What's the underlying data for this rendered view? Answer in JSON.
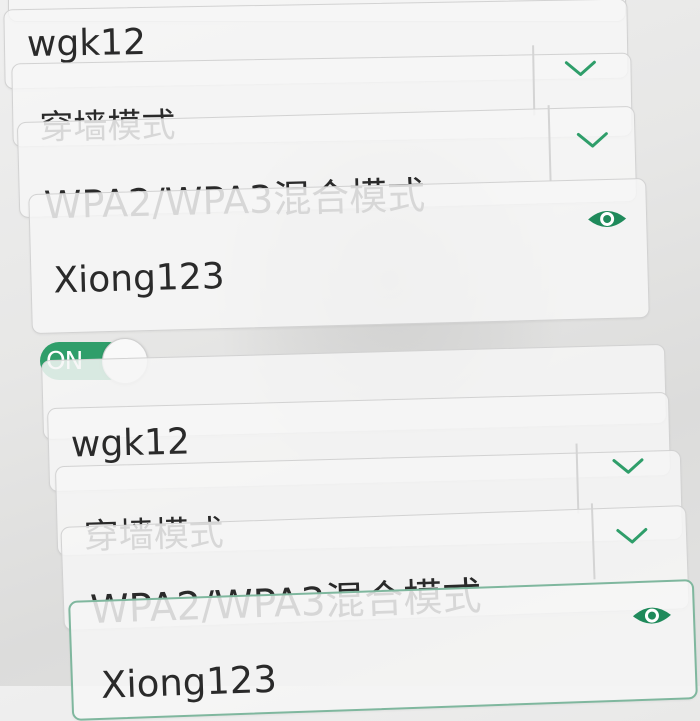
{
  "wifi_group_1": {
    "ssid": "wgk12",
    "mode": "穿墙模式",
    "security": "WPA2/WPA3混合模式",
    "password": "Xiong123"
  },
  "toggle": {
    "label": "ON",
    "state": "on"
  },
  "wifi_group_2": {
    "ssid": "wgk12",
    "mode": "穿墙模式",
    "security": "WPA2/WPA3混合模式",
    "password": "Xiong123"
  },
  "icons": {
    "select": "chevron-down-icon",
    "reveal": "eye-icon"
  },
  "colors": {
    "accent": "#2f9e6a",
    "icon": "#1f8a5b",
    "focus_border": "#7fb79e"
  }
}
